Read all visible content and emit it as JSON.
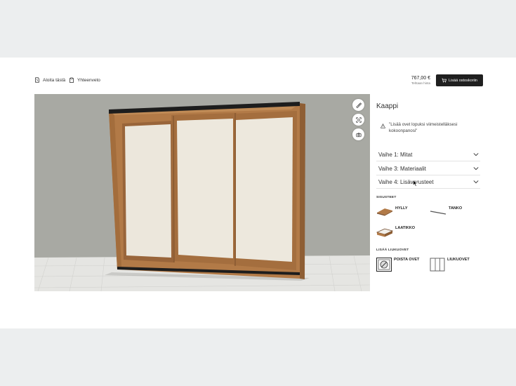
{
  "header": {
    "start_label": "Aloita tästä",
    "summary_label": "Yhteenveto",
    "price": "767,00 €",
    "price_note": "Tehtaan hinta",
    "cart_label": "Lisää ostoskoriin"
  },
  "panel": {
    "title": "Kaappi",
    "notice": "\"Lisää ovet lopuksi viimeistelläksesi kokoonpanosi\"",
    "steps": [
      {
        "label": "Vaihe 1: Mitat"
      },
      {
        "label": "Vaihe 3: Materiaalit"
      },
      {
        "label": "Vaihe 4: Lisävarusteet"
      }
    ],
    "interior_heading": "SISUSTEET",
    "interior_options": [
      {
        "label": "HYLLY",
        "icon": "shelf-icon"
      },
      {
        "label": "TANKO",
        "icon": "rod-icon"
      },
      {
        "label": "LAATIKKO",
        "icon": "drawer-icon"
      }
    ],
    "doors_heading": "LISÄÄ LIUKUOVET",
    "door_options": [
      {
        "label": "POISTA OVET",
        "icon": "remove-doors-icon"
      },
      {
        "label": "LIUKUOVET",
        "icon": "sliding-doors-icon"
      }
    ]
  },
  "viewer_tools": [
    "ruler-icon",
    "fullscreen-icon",
    "camera-icon"
  ],
  "colors": {
    "wall": "#a9aaa4",
    "floor": "#e4e4e1",
    "wood": "#b27a47",
    "panel_fill": "#ede8dd",
    "rail": "#1c1c1c",
    "button_dark": "#1f1f1f"
  }
}
